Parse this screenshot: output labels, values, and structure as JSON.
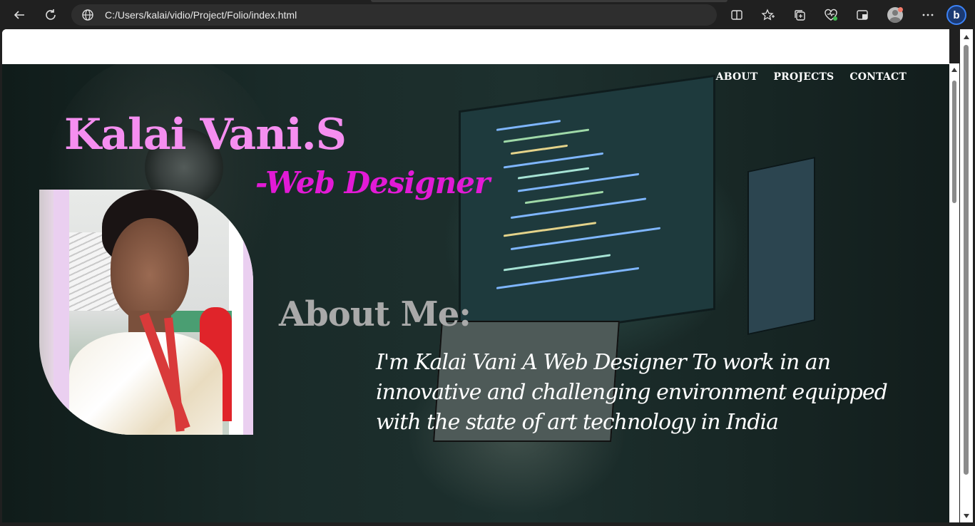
{
  "browser": {
    "url": "C:/Users/kalai/vidio/Project/Folio/index.html",
    "icons": [
      "back-icon",
      "refresh-icon",
      "globe-icon",
      "split-screen-icon",
      "favorites-icon",
      "collections-icon",
      "browser-essentials-icon",
      "extensions-icon",
      "profile-avatar",
      "more-icon",
      "bing-copilot-icon"
    ]
  },
  "nav": {
    "items": [
      {
        "label": "ABOUT"
      },
      {
        "label": "PROJECTS"
      },
      {
        "label": "CONTACT"
      }
    ]
  },
  "hero": {
    "name": "Kalai Vani.S",
    "role": "-Web Designer"
  },
  "about": {
    "title": "About Me:",
    "text": "I'm Kalai Vani A Web Designer  To work in an innovative and challenging environment equipped with the state of art technology in India"
  },
  "colors": {
    "name": "#f58ef0",
    "role": "#e21ad6",
    "about_title": "#a9a9a9"
  }
}
